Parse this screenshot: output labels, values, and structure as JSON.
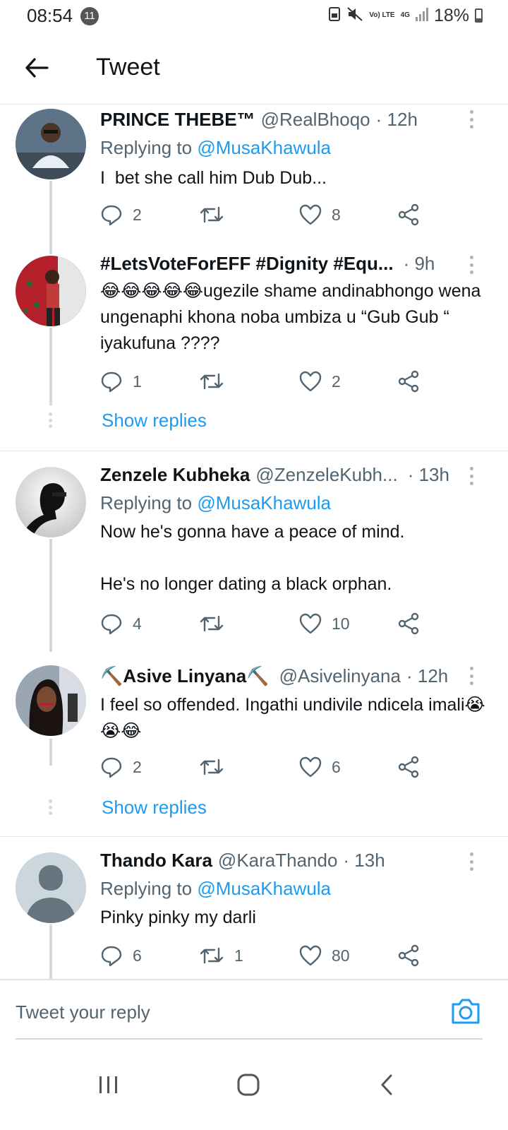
{
  "status_bar": {
    "time": "08:54",
    "notification_count": "11",
    "network_label": "Vo) LTE",
    "network_gen": "4G",
    "battery": "18%",
    "icons": [
      "lock-icon",
      "mute-icon",
      "signal-icon",
      "battery-icon"
    ]
  },
  "header": {
    "title": "Tweet",
    "back_icon": "arrow-left-icon"
  },
  "tweets": [
    {
      "name": "PRINCE THEBE™",
      "handle": "@RealBhoqo",
      "time": "· 12h",
      "replying_prefix": "Replying to ",
      "replying_to": "@MusaKhawula",
      "text": "I  bet she call him Dub Dub...",
      "replies": "2",
      "retweets": "",
      "likes": "8"
    },
    {
      "name": "#LetsVoteForEFF #Dignity #Equ...",
      "handle": "",
      "time": "· 9h",
      "text": "😂😂😂😂😂ugezile shame andinabhongo wena ungenaphi khona noba umbiza u “Gub Gub “ iyakufuna ????",
      "replies": "1",
      "retweets": "",
      "likes": "2",
      "show_replies": "Show replies"
    },
    {
      "name": "Zenzele Kubheka",
      "handle": "@ZenzeleKubh...",
      "time": "· 13h",
      "replying_prefix": "Replying to ",
      "replying_to": "@MusaKhawula",
      "text": "Now he's gonna have a peace of mind.\n\nHe's no longer dating a black orphan.",
      "replies": "4",
      "retweets": "",
      "likes": "10"
    },
    {
      "name": "⛏️Asive Linyana⛏️",
      "handle": "@Asivelinyana",
      "time": "· 12h",
      "text": "I feel so offended. Ingathi undivile ndicela imali😭😭😂",
      "replies": "2",
      "retweets": "",
      "likes": "6",
      "show_replies": "Show replies"
    },
    {
      "name": "Thando Kara",
      "handle": "@KaraThando",
      "time": "· 13h",
      "replying_prefix": "Replying to ",
      "replying_to": "@MusaKhawula",
      "text": "Pinky pinky my darli",
      "replies": "6",
      "retweets": "1",
      "likes": "80"
    }
  ],
  "reply_bar": {
    "placeholder": "Tweet your reply",
    "camera_icon": "camera-icon"
  },
  "nav_bar": {
    "icons": [
      "recent-apps-icon",
      "home-icon",
      "back-icon"
    ]
  },
  "colors": {
    "accent": "#1d9bf0",
    "secondary_text": "#536471",
    "primary_text": "#0f1419",
    "thread_line": "#cfd9de"
  }
}
